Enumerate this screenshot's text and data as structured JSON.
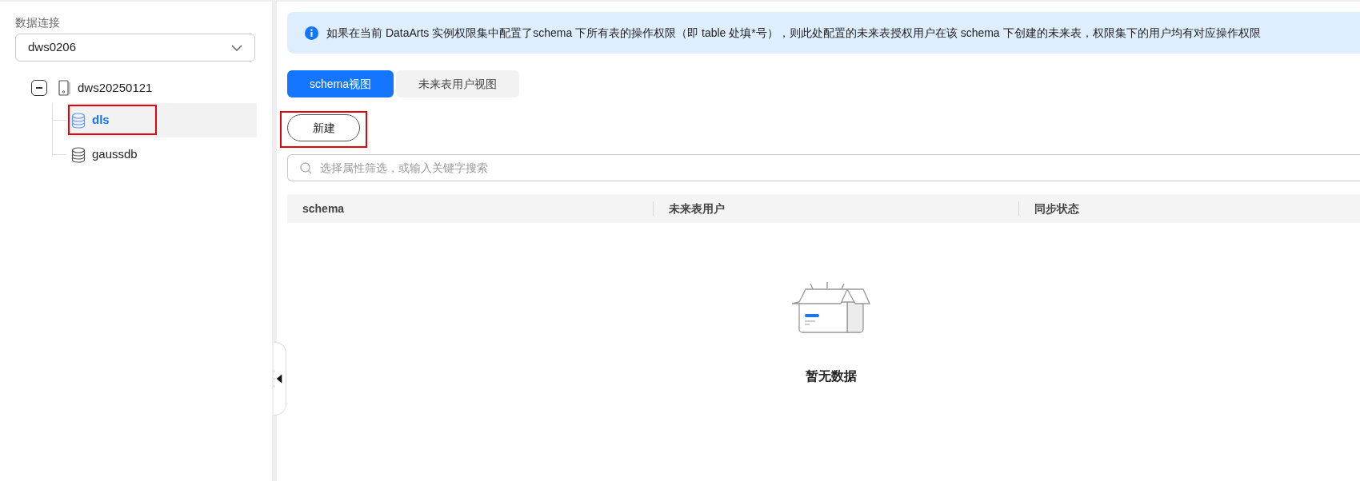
{
  "sidebar": {
    "label": "数据连接",
    "connection_select": {
      "value": "dws0206"
    },
    "tree": [
      {
        "label": "dws20250121",
        "kind": "server",
        "expanded": true,
        "selected": false,
        "children": [
          {
            "label": "dls",
            "kind": "database",
            "selected": true
          },
          {
            "label": "gaussdb",
            "kind": "database",
            "selected": false
          }
        ]
      }
    ]
  },
  "notice": "如果在当前 DataArts 实例权限集中配置了schema 下所有表的操作权限（即 table 处填*号），则此处配置的未来表授权用户在该 schema 下创建的未来表，权限集下的用户均有对应操作权限",
  "tabs": [
    {
      "label": "schema视图",
      "selected": true
    },
    {
      "label": "未来表用户视图",
      "selected": false
    }
  ],
  "new_button": "新建",
  "search": {
    "placeholder": "选择属性筛选，或输入关键字搜索"
  },
  "table": {
    "columns": [
      "schema",
      "未来表用户",
      "同步状态"
    ],
    "empty_text": "暂无数据"
  }
}
